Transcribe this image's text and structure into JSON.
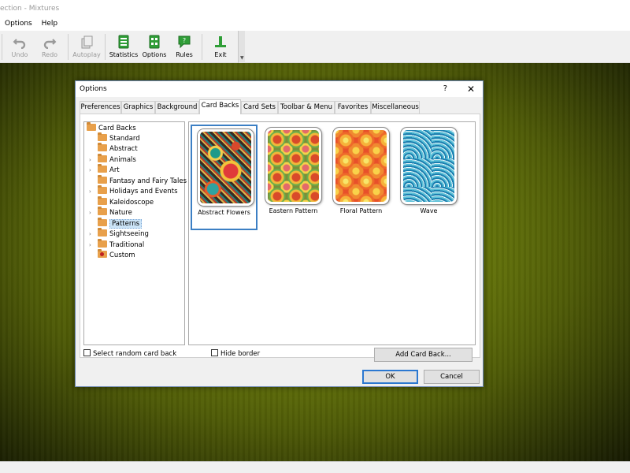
{
  "app": {
    "title": "ection  -  Mixtures",
    "menu": [
      "Options",
      "Help"
    ]
  },
  "toolbar": {
    "buttons": [
      {
        "label": "Undo",
        "icon": "undo-icon",
        "enabled": false
      },
      {
        "label": "Redo",
        "icon": "redo-icon",
        "enabled": false
      },
      {
        "label": "Autoplay",
        "icon": "autoplay-icon",
        "enabled": false
      },
      {
        "label": "Statistics",
        "icon": "statistics-icon",
        "enabled": true
      },
      {
        "label": "Options",
        "icon": "options-icon",
        "enabled": true
      },
      {
        "label": "Rules",
        "icon": "rules-icon",
        "enabled": true
      },
      {
        "label": "Exit",
        "icon": "exit-icon",
        "enabled": true
      }
    ]
  },
  "dialog": {
    "title": "Options",
    "help": "?",
    "close": "✕",
    "tabs": [
      "Preferences",
      "Graphics",
      "Background",
      "Card Backs",
      "Card Sets",
      "Toolbar & Menu",
      "Favorites",
      "Miscellaneous"
    ],
    "active_tab": "Card Backs",
    "tree": {
      "root": "Card Backs",
      "items": [
        {
          "label": "Standard",
          "expandable": false
        },
        {
          "label": "Abstract",
          "expandable": false
        },
        {
          "label": "Animals",
          "expandable": true
        },
        {
          "label": "Art",
          "expandable": true
        },
        {
          "label": "Fantasy and Fairy Tales",
          "expandable": false
        },
        {
          "label": "Holidays and Events",
          "expandable": true
        },
        {
          "label": "Kaleidoscope",
          "expandable": false
        },
        {
          "label": "Nature",
          "expandable": true
        },
        {
          "label": "Patterns",
          "expandable": false,
          "selected": true
        },
        {
          "label": "Sightseeing",
          "expandable": true
        },
        {
          "label": "Traditional",
          "expandable": true
        },
        {
          "label": "Custom",
          "expandable": false,
          "custom": true
        }
      ]
    },
    "cards": [
      {
        "label": "Abstract Flowers",
        "selected": true
      },
      {
        "label": "Eastern Pattern",
        "selected": false
      },
      {
        "label": "Floral Pattern",
        "selected": false
      },
      {
        "label": "Wave",
        "selected": false
      }
    ],
    "random_card_back_label": "Select random card back",
    "hide_border_label": "Hide border",
    "add_card_back_label": "Add Card Back...",
    "ok_label": "OK",
    "cancel_label": "Cancel"
  },
  "colors": {
    "felt": "#6e7f0c",
    "selection_border": "#3c7fc4",
    "default_button_border": "#2b78d1"
  }
}
